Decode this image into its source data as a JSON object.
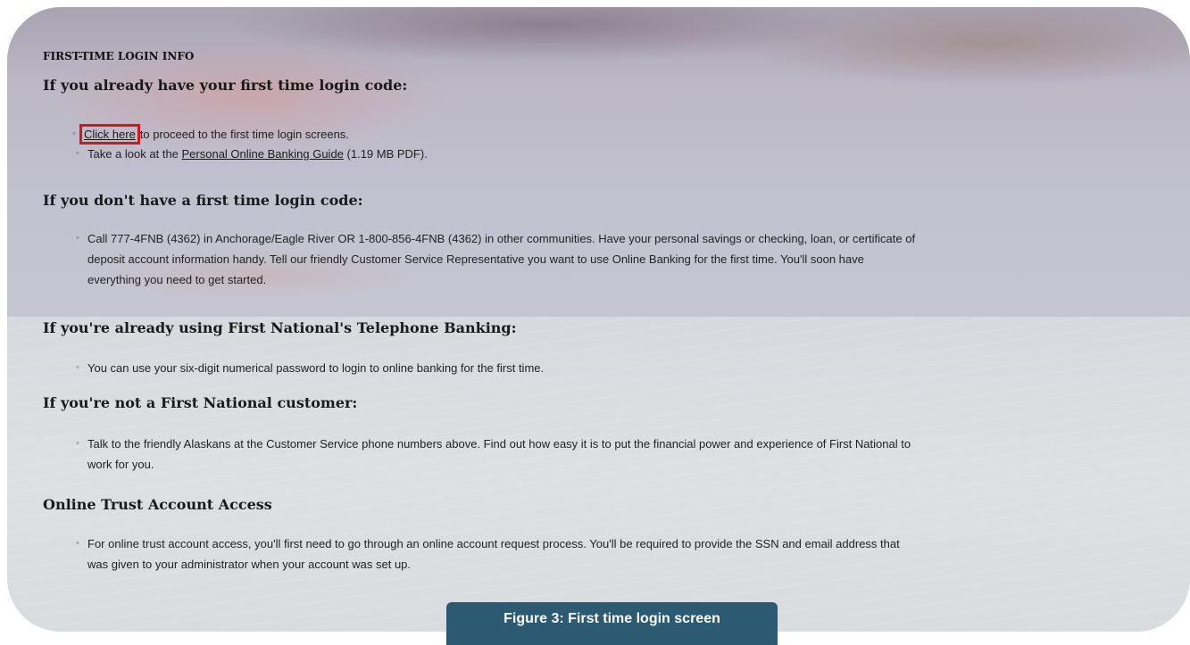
{
  "section_label": "FIRST-TIME LOGIN INFO",
  "sections": [
    {
      "heading": "If you already have your first time login code:",
      "items": [
        {
          "link": "Click here",
          "text": "to proceed to the first time login screens."
        },
        {
          "prefix": "Take a look at the ",
          "link": "Personal Online Banking Guide",
          "suffix": " (1.19 MB PDF)."
        }
      ]
    },
    {
      "heading": "If you don't have a first time login code:",
      "items": [
        {
          "line1": "Call 777-4FNB (4362) in Anchorage/Eagle River OR 1-800-856-4FNB (4362) in other communities. Have your personal savings or checking, loan, or certificate of",
          "line2": "deposit account information handy. Tell our friendly Customer Service Representative you want to use Online Banking for the first time. You'll soon have",
          "line3": "everything you need to get started."
        }
      ]
    },
    {
      "heading": "If you're already using First National's Telephone Banking:",
      "items": [
        {
          "line1": "You can use your six-digit numerical password to login to online banking for the first time."
        }
      ]
    },
    {
      "heading": "If you're not a First National customer:",
      "items": [
        {
          "line1": "Talk to the friendly Alaskans at the Customer Service phone numbers above. Find out how easy it is to put the financial power and experience of First National to",
          "line2": "work for you."
        }
      ]
    },
    {
      "heading": "Online Trust Account Access",
      "items": [
        {
          "line1": "For online trust account access, you'll first need to go through an online account request process. You'll be required to provide the SSN and email address that",
          "line2": "was given to your administrator when your account was set up."
        }
      ]
    }
  ],
  "caption": "Figure 3: First time login screen",
  "colors": {
    "highlight": "#d5161b",
    "caption_bg": "#2b5a72"
  }
}
